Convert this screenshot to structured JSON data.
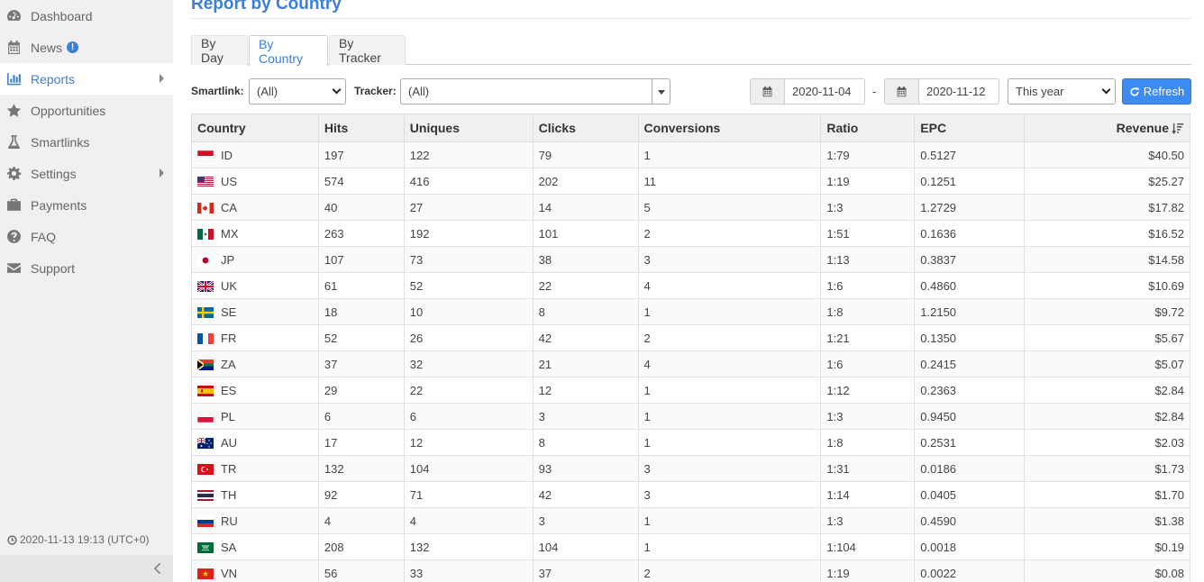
{
  "sidebar": {
    "items": [
      {
        "label": "Dashboard",
        "icon": "dashboard-icon"
      },
      {
        "label": "News",
        "icon": "calendar-icon",
        "badge": "!"
      },
      {
        "label": "Reports",
        "icon": "bar-chart-icon"
      },
      {
        "label": "Opportunities",
        "icon": "star-icon"
      },
      {
        "label": "Smartlinks",
        "icon": "flask-icon"
      },
      {
        "label": "Settings",
        "icon": "gear-icon"
      },
      {
        "label": "Payments",
        "icon": "briefcase-icon"
      },
      {
        "label": "FAQ",
        "icon": "question-icon"
      },
      {
        "label": "Support",
        "icon": "envelope-icon"
      }
    ],
    "clock": "2020-11-13 19:13 (UTC+0)"
  },
  "page": {
    "title": "Report by Country"
  },
  "tabs": [
    "By Day",
    "By Country",
    "By Tracker"
  ],
  "filters": {
    "smartlink_label": "Smartlink:",
    "smartlink_value": "(All)",
    "tracker_label": "Tracker:",
    "tracker_value": "(All)",
    "date_from": "2020-11-04",
    "date_sep": "-",
    "date_to": "2020-11-12",
    "period": "This year",
    "refresh_label": "Refresh"
  },
  "table": {
    "columns": [
      "Country",
      "Hits",
      "Uniques",
      "Clicks",
      "Conversions",
      "Ratio",
      "EPC",
      "Revenue"
    ],
    "rows": [
      {
        "cc": "ID",
        "hits": "197",
        "uniques": "122",
        "clicks": "79",
        "conversions": "1",
        "ratio": "1:79",
        "epc": "0.5127",
        "revenue": "$40.50"
      },
      {
        "cc": "US",
        "hits": "574",
        "uniques": "416",
        "clicks": "202",
        "conversions": "11",
        "ratio": "1:19",
        "epc": "0.1251",
        "revenue": "$25.27"
      },
      {
        "cc": "CA",
        "hits": "40",
        "uniques": "27",
        "clicks": "14",
        "conversions": "5",
        "ratio": "1:3",
        "epc": "1.2729",
        "revenue": "$17.82"
      },
      {
        "cc": "MX",
        "hits": "263",
        "uniques": "192",
        "clicks": "101",
        "conversions": "2",
        "ratio": "1:51",
        "epc": "0.1636",
        "revenue": "$16.52"
      },
      {
        "cc": "JP",
        "hits": "107",
        "uniques": "73",
        "clicks": "38",
        "conversions": "3",
        "ratio": "1:13",
        "epc": "0.3837",
        "revenue": "$14.58"
      },
      {
        "cc": "UK",
        "hits": "61",
        "uniques": "52",
        "clicks": "22",
        "conversions": "4",
        "ratio": "1:6",
        "epc": "0.4860",
        "revenue": "$10.69"
      },
      {
        "cc": "SE",
        "hits": "18",
        "uniques": "10",
        "clicks": "8",
        "conversions": "1",
        "ratio": "1:8",
        "epc": "1.2150",
        "revenue": "$9.72"
      },
      {
        "cc": "FR",
        "hits": "52",
        "uniques": "26",
        "clicks": "42",
        "conversions": "2",
        "ratio": "1:21",
        "epc": "0.1350",
        "revenue": "$5.67"
      },
      {
        "cc": "ZA",
        "hits": "37",
        "uniques": "32",
        "clicks": "21",
        "conversions": "4",
        "ratio": "1:6",
        "epc": "0.2415",
        "revenue": "$5.07"
      },
      {
        "cc": "ES",
        "hits": "29",
        "uniques": "22",
        "clicks": "12",
        "conversions": "1",
        "ratio": "1:12",
        "epc": "0.2363",
        "revenue": "$2.84"
      },
      {
        "cc": "PL",
        "hits": "6",
        "uniques": "6",
        "clicks": "3",
        "conversions": "1",
        "ratio": "1:3",
        "epc": "0.9450",
        "revenue": "$2.84"
      },
      {
        "cc": "AU",
        "hits": "17",
        "uniques": "12",
        "clicks": "8",
        "conversions": "1",
        "ratio": "1:8",
        "epc": "0.2531",
        "revenue": "$2.03"
      },
      {
        "cc": "TR",
        "hits": "132",
        "uniques": "104",
        "clicks": "93",
        "conversions": "3",
        "ratio": "1:31",
        "epc": "0.0186",
        "revenue": "$1.73"
      },
      {
        "cc": "TH",
        "hits": "92",
        "uniques": "71",
        "clicks": "42",
        "conversions": "3",
        "ratio": "1:14",
        "epc": "0.0405",
        "revenue": "$1.70"
      },
      {
        "cc": "RU",
        "hits": "4",
        "uniques": "4",
        "clicks": "3",
        "conversions": "1",
        "ratio": "1:3",
        "epc": "0.4590",
        "revenue": "$1.38"
      },
      {
        "cc": "SA",
        "hits": "208",
        "uniques": "132",
        "clicks": "104",
        "conversions": "1",
        "ratio": "1:104",
        "epc": "0.0018",
        "revenue": "$0.19"
      },
      {
        "cc": "VN",
        "hits": "56",
        "uniques": "33",
        "clicks": "37",
        "conversions": "2",
        "ratio": "1:19",
        "epc": "0.0022",
        "revenue": "$0.08"
      }
    ]
  },
  "colors": {
    "accent": "#3c7fd6",
    "button": "#3d8bf2",
    "sidebar_bg": "#f0f0f0"
  }
}
